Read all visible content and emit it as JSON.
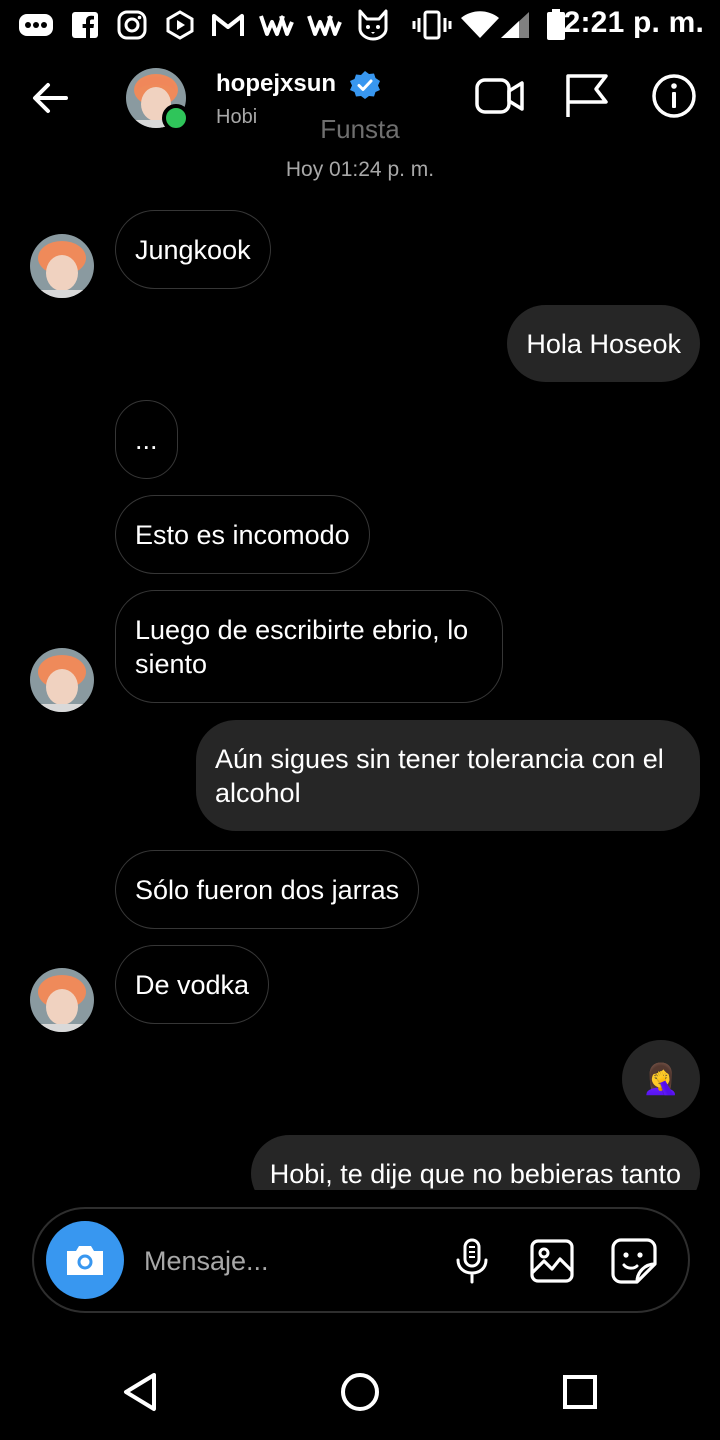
{
  "status_bar": {
    "time": "2:21 p. m.",
    "icons": [
      "messenger-dots-icon",
      "facebook-icon",
      "instagram-icon",
      "hexagon-app-icon",
      "gmail-icon",
      "webtoon-icon",
      "webtoon-icon",
      "fox-app-icon",
      "vibrate-icon",
      "wifi-icon",
      "cell-signal-icon",
      "battery-icon"
    ]
  },
  "header": {
    "username": "hopejxsun",
    "subtitle": "Hobi",
    "note": "Funsta",
    "online_color": "#2fc55a",
    "verified_color": "#3897f0"
  },
  "timestamp": "Hoy 01:24 p. m.",
  "messages": [
    {
      "from": "them",
      "text": "Jungkook"
    },
    {
      "from": "me",
      "text": "Hola Hoseok"
    },
    {
      "from": "them",
      "text": "..."
    },
    {
      "from": "them",
      "text": "Esto es incomodo"
    },
    {
      "from": "them",
      "text": "Luego de escribirte ebrio, lo siento"
    },
    {
      "from": "me",
      "text": "Aún sigues sin tener tolerancia con el alcohol"
    },
    {
      "from": "them",
      "text": "Sólo fueron dos jarras"
    },
    {
      "from": "them",
      "text": "De vodka"
    },
    {
      "from": "me",
      "text": "🤦‍♀️"
    },
    {
      "from": "me",
      "text": "Hobi, te dije que no bebieras tanto"
    }
  ],
  "composer": {
    "placeholder": "Mensaje...",
    "accent": "#3897f0"
  },
  "colors": {
    "background": "#000000",
    "sent_bubble": "#262626",
    "received_border": "#363636"
  }
}
